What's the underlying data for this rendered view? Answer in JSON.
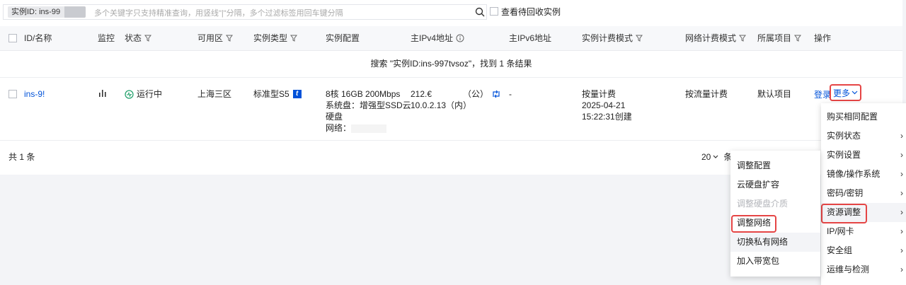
{
  "search": {
    "chip_label": "实例ID: ins-99",
    "placeholder": "多个关键字只支持精准查询，用竖线\"|\"分隔，多个过滤标签用回车键分隔",
    "recycle_label": "查看待回收实例"
  },
  "table": {
    "headers": {
      "id": "ID/名称",
      "monitor": "监控",
      "status": "状态",
      "zone": "可用区",
      "type": "实例类型",
      "config": "实例配置",
      "ipv4": "主IPv4地址",
      "ipv6": "主IPv6地址",
      "billing": "实例计费模式",
      "net_billing": "网络计费模式",
      "project": "所属项目",
      "ops": "操作"
    },
    "search_result": "搜索 \"实例ID:ins-997tvsoz\"，找到 1 条结果",
    "row": {
      "id": "ins-9!",
      "status": "运行中",
      "zone": "上海三区",
      "type": "标准型S5",
      "type_badge": "t",
      "config_line1": "8核 16GB 200Mbps",
      "config_line2": "系统盘：增强型SSD云",
      "config_line3": "硬盘",
      "config_line4": "网络：",
      "ipv4_public": "212.€",
      "ipv4_public_tag": "（公）",
      "ipv4_private": "10.0.2.13（内）",
      "ipv6": "-",
      "billing_mode": "按量计费",
      "billing_date": "2025-04-21",
      "billing_time": "15:22:31创建",
      "net_billing": "按流量计费",
      "project": "默认项目",
      "login": "登录",
      "more": "更多"
    },
    "total": "共 1 条",
    "page_size": "20",
    "page_size_suffix": "条"
  },
  "more_menu": {
    "items": [
      {
        "label": "购买相同配置",
        "has_sub": false
      },
      {
        "label": "实例状态",
        "has_sub": true
      },
      {
        "label": "实例设置",
        "has_sub": true
      },
      {
        "label": "镜像/操作系统",
        "has_sub": true
      },
      {
        "label": "密码/密钥",
        "has_sub": true
      },
      {
        "label": "资源调整",
        "has_sub": true
      },
      {
        "label": "IP/网卡",
        "has_sub": true
      },
      {
        "label": "安全组",
        "has_sub": true
      },
      {
        "label": "运维与检测",
        "has_sub": true
      }
    ]
  },
  "sub_menu": {
    "items": [
      {
        "label": "调整配置"
      },
      {
        "label": "云硬盘扩容"
      },
      {
        "label": "调整硬盘介质"
      },
      {
        "label": "调整网络"
      },
      {
        "label": "切换私有网络"
      },
      {
        "label": "加入带宽包"
      }
    ]
  },
  "colors": {
    "accent": "#0052d9",
    "highlight": "#e54545",
    "running": "#2ba471"
  }
}
